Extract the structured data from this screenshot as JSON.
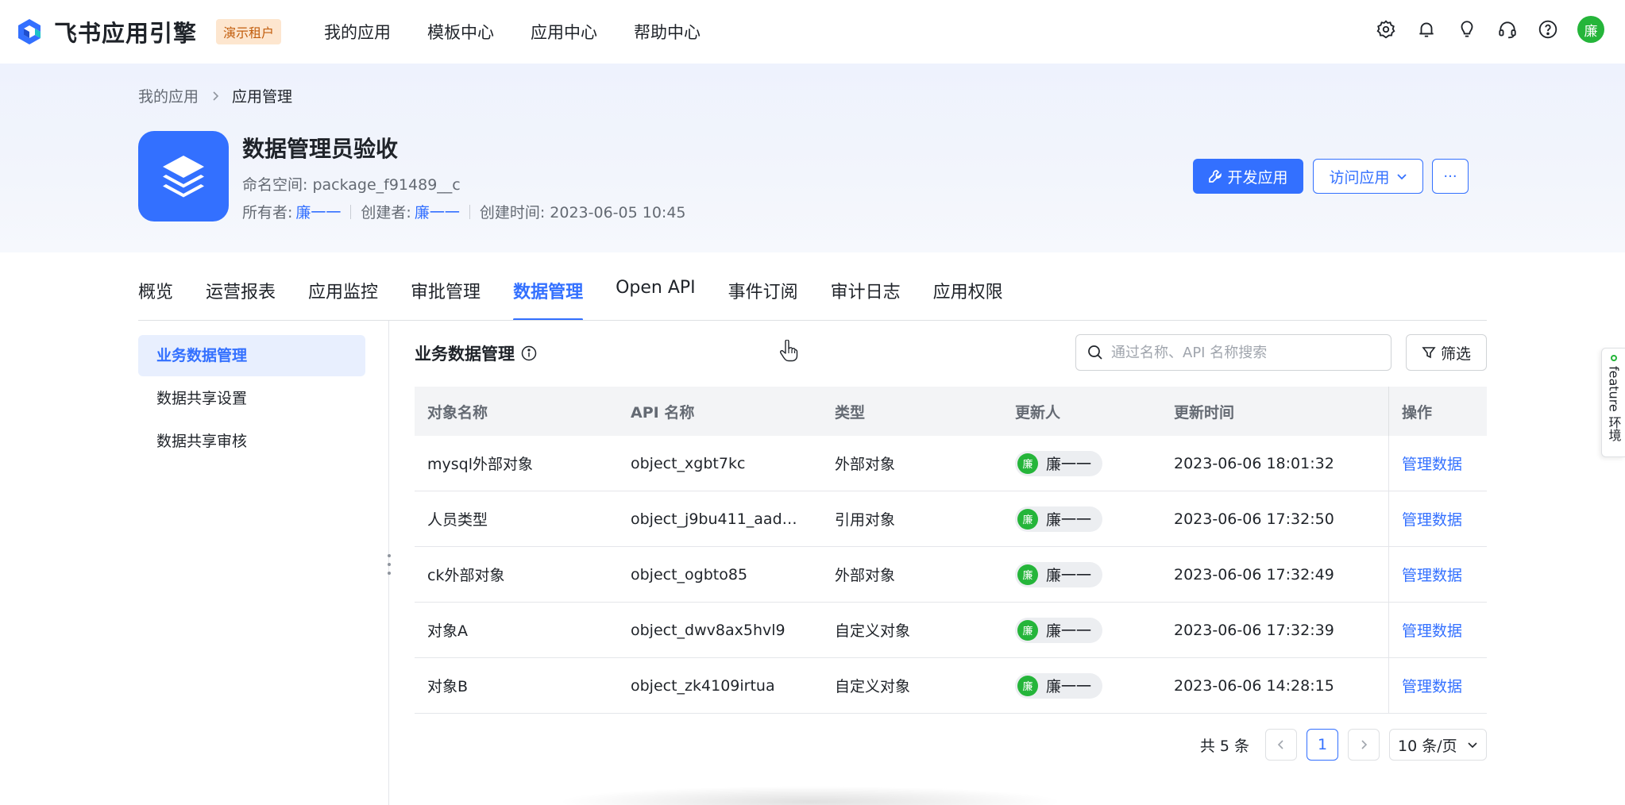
{
  "brand": {
    "name": "飞书应用引擎",
    "tenant_badge": "演示租户"
  },
  "top_nav": [
    "我的应用",
    "模板中心",
    "应用中心",
    "帮助中心"
  ],
  "top_icons": [
    "settings-icon",
    "bell-icon",
    "lightbulb-icon",
    "headset-icon",
    "help-icon"
  ],
  "user": {
    "avatar_text": "廉"
  },
  "breadcrumb": {
    "parent": "我的应用",
    "current": "应用管理"
  },
  "app": {
    "title": "数据管理员验收",
    "namespace": "命名空间: package_f91489__c",
    "owner_label": "所有者:",
    "owner": "廉一一",
    "creator_label": "创建者:",
    "creator": "廉一一",
    "created_at": "创建时间:  2023-06-05 10:45"
  },
  "actions": {
    "develop": "开发应用",
    "visit": "访问应用",
    "more": "···"
  },
  "tabs": [
    "概览",
    "运营报表",
    "应用监控",
    "审批管理",
    "数据管理",
    "Open API",
    "事件订阅",
    "审计日志",
    "应用权限"
  ],
  "active_tab": "数据管理",
  "side_menu": [
    "业务数据管理",
    "数据共享设置",
    "数据共享审核"
  ],
  "section": {
    "title": "业务数据管理",
    "search_placeholder": "通过名称、API 名称搜索",
    "filter_label": "筛选"
  },
  "table": {
    "columns": [
      "对象名称",
      "API 名称",
      "类型",
      "更新人",
      "更新时间",
      "操作"
    ],
    "rows": [
      {
        "name": "mysql外部对象",
        "api": "object_xgbt7kc",
        "type": "外部对象",
        "updater": "廉一一",
        "updater_avatar": "廉",
        "time": "2023-06-06 18:01:32",
        "action": "管理数据"
      },
      {
        "name": "人员类型",
        "api": "object_j9bu411_aade…",
        "type": "引用对象",
        "updater": "廉一一",
        "updater_avatar": "廉",
        "time": "2023-06-06 17:32:50",
        "action": "管理数据"
      },
      {
        "name": "ck外部对象",
        "api": "object_ogbto85",
        "type": "外部对象",
        "updater": "廉一一",
        "updater_avatar": "廉",
        "time": "2023-06-06 17:32:49",
        "action": "管理数据"
      },
      {
        "name": "对象A",
        "api": "object_dwv8ax5hvl9",
        "type": "自定义对象",
        "updater": "廉一一",
        "updater_avatar": "廉",
        "time": "2023-06-06 17:32:39",
        "action": "管理数据"
      },
      {
        "name": "对象B",
        "api": "object_zk4109irtua",
        "type": "自定义对象",
        "updater": "廉一一",
        "updater_avatar": "廉",
        "time": "2023-06-06 14:28:15",
        "action": "管理数据"
      }
    ]
  },
  "pagination": {
    "total": "共 5 条",
    "current_page": "1",
    "page_size": "10 条/页"
  },
  "feature_tab": "feature 环境",
  "colors": {
    "primary": "#3370ff",
    "avatar_green": "#25b53a",
    "tenant_badge_bg": "#fde6cf"
  }
}
